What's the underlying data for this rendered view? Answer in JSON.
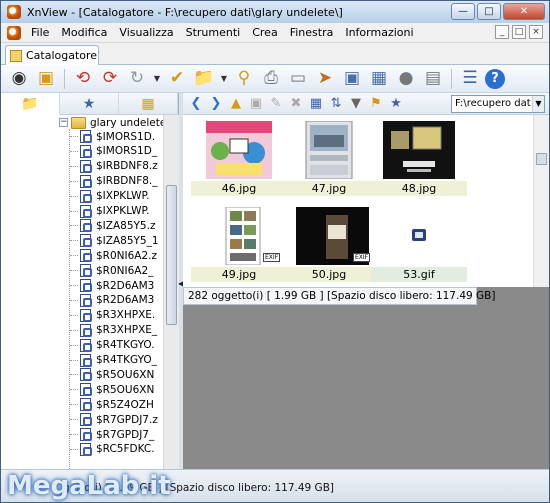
{
  "window": {
    "title": "XnView - [Catalogatore - F:\\recupero dati\\glary undelete\\]"
  },
  "menu": {
    "items": [
      "File",
      "Modifica",
      "Visualizza",
      "Strumenti",
      "Crea",
      "Finestra",
      "Informazioni"
    ]
  },
  "tabs": [
    {
      "label": "Catalogatore"
    }
  ],
  "tree": {
    "root_label": "glary undelete",
    "items": [
      "$IMORS1D.",
      "$IMORS1D_",
      "$IRBDNF8.z",
      "$IRBDNF8._",
      "$IXPKLWP.",
      "$IXPKLWP.",
      "$IZA85Y5.z",
      "$IZA85Y5_1",
      "$R0NI6A2.z",
      "$R0NI6A2_",
      "$R2D6AM3",
      "$R2D6AM3",
      "$R3XHPXE.",
      "$R3XHPXE_",
      "$R4TKGYO.",
      "$R4TKGYO_",
      "$R5OU6XN",
      "$R5OU6XN",
      "$R5Z4OZH",
      "$R7GPDJ7.z",
      "$R7GPDJ7_",
      "$RC5FDKC."
    ]
  },
  "nav": {
    "path_value": "F:\\recupero dat"
  },
  "thumbnails": [
    {
      "name": "46.jpg"
    },
    {
      "name": "47.jpg"
    },
    {
      "name": "48.jpg"
    },
    {
      "name": "49.jpg",
      "badge": "EXIF"
    },
    {
      "name": "50.jpg",
      "badge": "EXIF"
    },
    {
      "name": "53.gif"
    }
  ],
  "status": {
    "popup_text": "282 oggetto(i) [ 1.99 GB ] [Spazio disco libero: 117.49 GB]",
    "bar_text": "getto(i) [ 1.99 GB ] [Spazio disco libero: 117.49 GB]"
  },
  "watermark": {
    "text": "MegaLab.it"
  }
}
